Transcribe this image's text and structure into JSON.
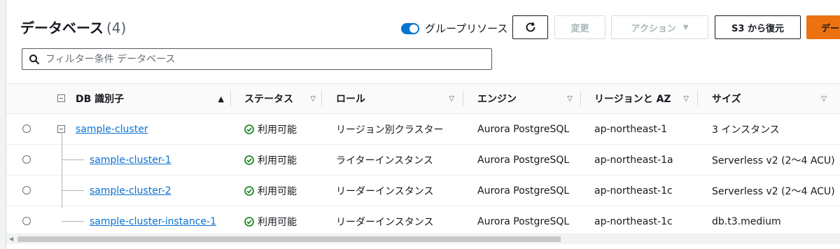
{
  "header": {
    "title": "データベース",
    "count": "(4)",
    "group_toggle_label": "グループリソース",
    "buttons": {
      "change": "変更",
      "action": "アクション",
      "restore": "S3 から復元",
      "create": "デー"
    }
  },
  "search": {
    "placeholder": "フィルター条件 データベース",
    "value": ""
  },
  "table": {
    "columns": [
      "DB 識別子",
      "ステータス",
      "ロール",
      "エンジン",
      "リージョンと AZ",
      "サイズ"
    ],
    "rows": [
      {
        "id": "sample-cluster",
        "status": "利用可能",
        "role": "リージョン別クラスター",
        "engine": "Aurora PostgreSQL",
        "region": "ap-northeast-1",
        "size": "3 インスタンス"
      },
      {
        "id": "sample-cluster-1",
        "status": "利用可能",
        "role": "ライターインスタンス",
        "engine": "Aurora PostgreSQL",
        "region": "ap-northeast-1a",
        "size": "Serverless v2 (2～4 ACU)"
      },
      {
        "id": "sample-cluster-2",
        "status": "利用可能",
        "role": "リーダーインスタンス",
        "engine": "Aurora PostgreSQL",
        "region": "ap-northeast-1c",
        "size": "Serverless v2 (2～4 ACU)"
      },
      {
        "id": "sample-cluster-instance-1",
        "status": "利用可能",
        "role": "リーダーインスタンス",
        "engine": "Aurora PostgreSQL",
        "region": "ap-northeast-1c",
        "size": "db.t3.medium"
      }
    ]
  },
  "colors": {
    "link": "#0972d3",
    "status_ok": "#037f0c",
    "primary": "#ec7211"
  }
}
